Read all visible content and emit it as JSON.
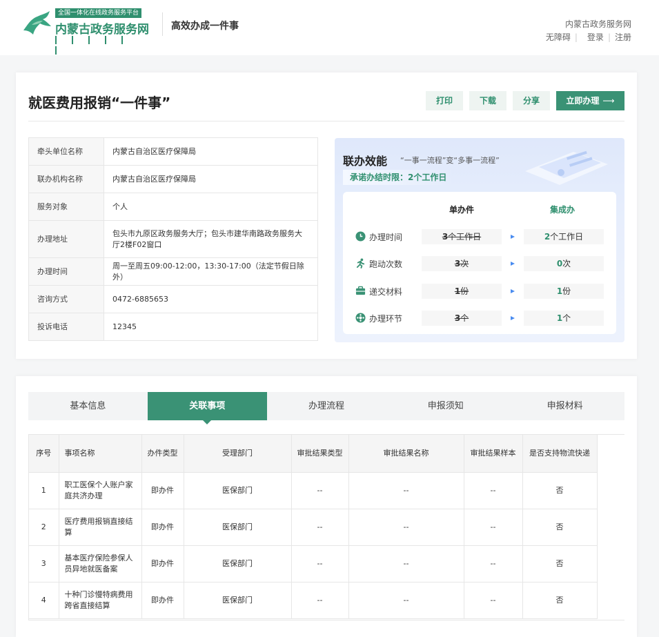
{
  "header": {
    "logo_tag": "全国一体化在线政务服务平台",
    "logo_title": "内蒙古政务服务网",
    "slogan": "高效办成一件事",
    "site_name": "内蒙古政务服务网",
    "links": [
      "无障碍",
      "登录",
      "注册"
    ]
  },
  "detail": {
    "title": "就医费用报销“一件事”",
    "buttons": {
      "print": "打印",
      "download": "下载",
      "share": "分享",
      "apply": "立即办理",
      "apply_arrow": "⟶"
    },
    "info": [
      {
        "label": "牵头单位名称",
        "value": "内蒙古自治区医疗保障局"
      },
      {
        "label": "联办机构名称",
        "value": "内蒙古自治区医疗保障局"
      },
      {
        "label": "服务对象",
        "value": "个人"
      },
      {
        "label": "办理地址",
        "value": "包头市九原区政务服务大厅；包头市建华南路政务服务大厅2楼F02窗口"
      },
      {
        "label": "办理时间",
        "value": "周一至周五09:00-12:00，13:30-17:00（法定节假日除外）"
      },
      {
        "label": "咨询方式",
        "value": "0472-6885653"
      },
      {
        "label": "投诉电话",
        "value": "12345"
      }
    ]
  },
  "efficiency": {
    "title": "联办效能",
    "subtitle": "“一事一流程”变“多事一流程”",
    "promise_label": "承诺办结时限：",
    "promise_value": "2个工作日",
    "col_single": "单办件",
    "col_combined": "集成办",
    "rows": [
      {
        "icon": "clock-icon",
        "label": "办理时间",
        "old_num": "3",
        "old_unit": "个工作日",
        "new_num": "2",
        "new_unit": "个工作日"
      },
      {
        "icon": "running-icon",
        "label": "跑动次数",
        "old_num": "3",
        "old_unit": "次",
        "new_num": "0",
        "new_unit": "次"
      },
      {
        "icon": "briefcase-icon",
        "label": "递交材料",
        "old_num": "1",
        "old_unit": "份",
        "new_num": "1",
        "new_unit": "份"
      },
      {
        "icon": "process-icon",
        "label": "办理环节",
        "old_num": "3",
        "old_unit": "个",
        "new_num": "1",
        "new_unit": "个"
      }
    ],
    "colors": {
      "accent": "#2f8f6e",
      "arrow": "#4a8cf0"
    }
  },
  "tabs": {
    "items": [
      "基本信息",
      "关联事项",
      "办理流程",
      "申报须知",
      "申报材料"
    ],
    "active": "关联事项"
  },
  "items_table": {
    "headers": [
      "序号",
      "事项名称",
      "办件类型",
      "受理部门",
      "审批结果类型",
      "审批结果名称",
      "审批结果样本",
      "是否支持物流快递"
    ],
    "rows": [
      [
        "1",
        "职工医保个人账户家庭共济办理",
        "即办件",
        "医保部门",
        "--",
        "--",
        "--",
        "否"
      ],
      [
        "2",
        "医疗费用报销直接结算",
        "即办件",
        "医保部门",
        "--",
        "--",
        "--",
        "否"
      ],
      [
        "3",
        "基本医疗保险参保人员异地就医备案",
        "即办件",
        "医保部门",
        "--",
        "--",
        "--",
        "否"
      ],
      [
        "4",
        "十种门诊慢特病费用跨省直接结算",
        "即办件",
        "医保部门",
        "--",
        "--",
        "--",
        "否"
      ]
    ]
  }
}
